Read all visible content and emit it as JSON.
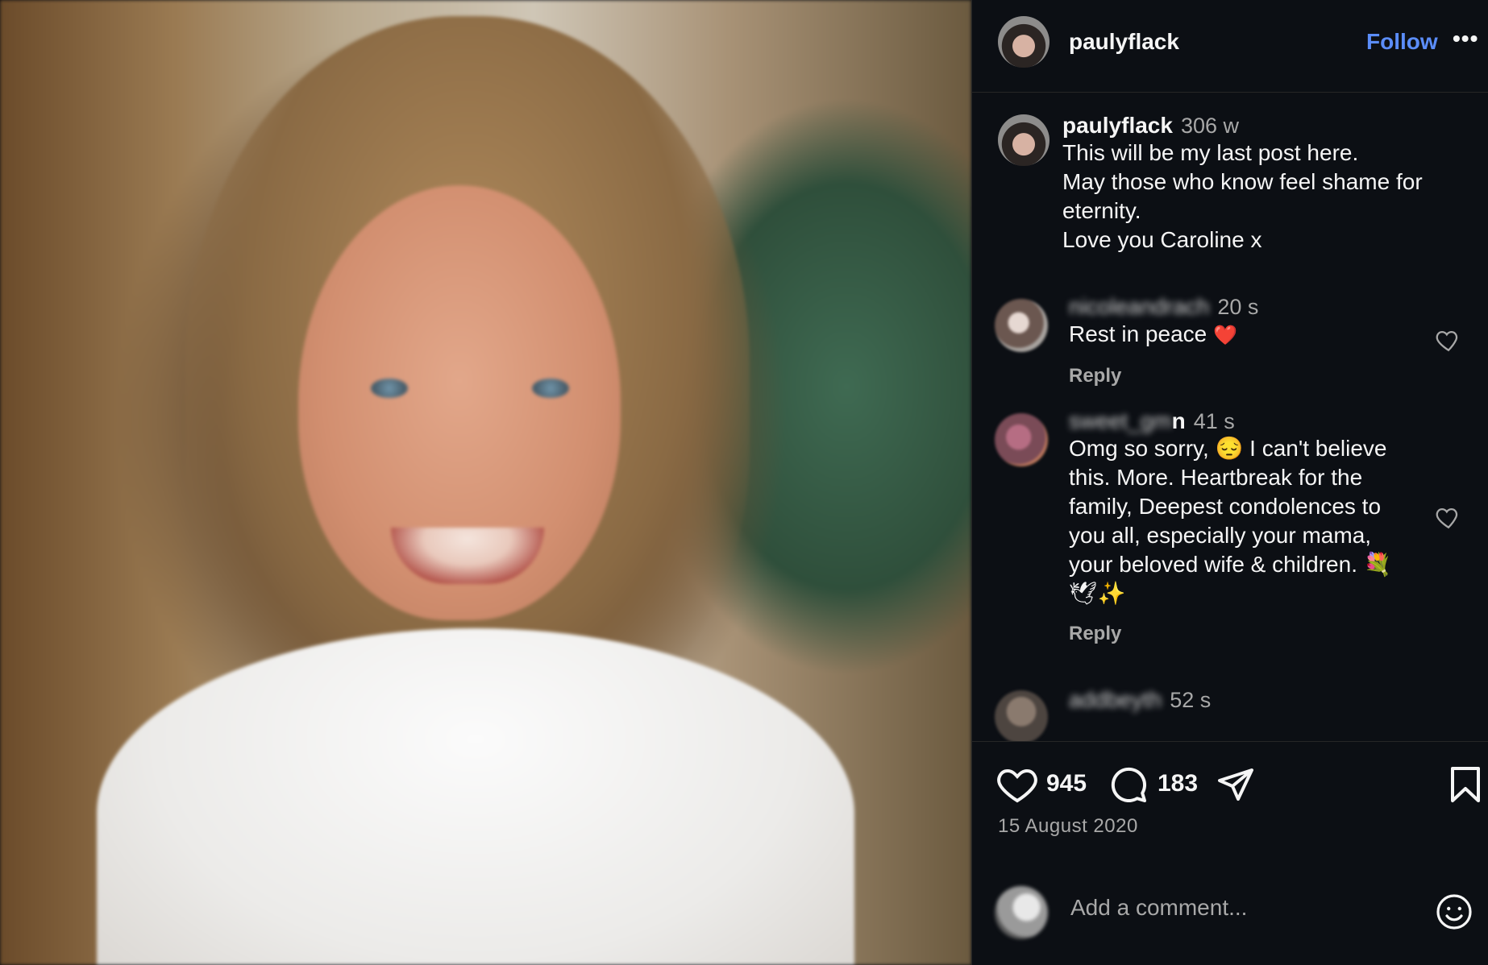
{
  "post": {
    "image_alt": "Photo of a smiling young girl",
    "author": "paulyflack",
    "follow_label": "Follow",
    "more_label": "•••"
  },
  "caption": {
    "author": "paulyflack",
    "time": "306 w",
    "lines": [
      "This will be my last post here.",
      "May those who know feel shame for eternity.",
      "Love you Caroline x"
    ]
  },
  "comments": [
    {
      "author_blurred": "nicoleandrach",
      "time": "20 s",
      "text": "Rest in peace",
      "emoji": "❤️",
      "reply_label": "Reply"
    },
    {
      "author_blurred": "sweet_gm",
      "author_tail": "n",
      "time": "41 s",
      "text": "Omg so sorry, 😔 I can't believe this. More. Heartbreak for the family, Deepest condolences to you all, especially your mama, your beloved wife & children. 💐🕊✨",
      "reply_label": "Reply"
    },
    {
      "author_blurred": "addbeyth",
      "time": "52 s"
    }
  ],
  "actions": {
    "likes": "945",
    "comments": "183",
    "date": "15 August 2020"
  },
  "composer": {
    "placeholder": "Add a comment..."
  },
  "icons": [
    "heart-icon",
    "comment-icon",
    "share-icon",
    "bookmark-icon",
    "emoji-icon",
    "more-icon"
  ]
}
